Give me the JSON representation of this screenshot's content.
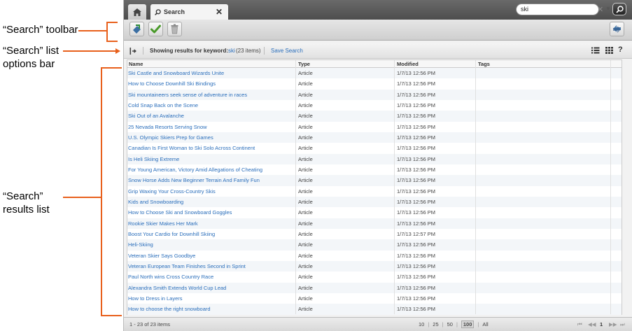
{
  "annotations": {
    "toolbar": "“Search” toolbar",
    "options_line1": "“Search” list",
    "options_line2": "options bar",
    "results_line1": "“Search”",
    "results_line2": "results list"
  },
  "tabs": {
    "home_icon": "home-icon",
    "search_tab_label": "Search",
    "close_symbol": "✕"
  },
  "global_search": {
    "value": "ski",
    "clear_symbol": "✕",
    "dropdown_symbol": "▼"
  },
  "toolbar": {
    "buttons": [
      "publish-icon",
      "approve-icon",
      "delete-icon"
    ],
    "right_button": "sync-icon"
  },
  "options_bar": {
    "showing_prefix": "Showing results for keyword:",
    "keyword": "ski",
    "count": "(23 items)",
    "save_search": "Save Search",
    "help": "?"
  },
  "table": {
    "columns": [
      "Name",
      "Type",
      "Modified",
      "Tags"
    ],
    "rows": [
      {
        "name": "Ski Castle and Snowboard Wizards Unite",
        "type": "Article",
        "modified": "1/7/13 12:56 PM"
      },
      {
        "name": "How to Choose Downhill Ski Bindings",
        "type": "Article",
        "modified": "1/7/13 12:56 PM"
      },
      {
        "name": "Ski mountaineers seek sense of adventure in races",
        "type": "Article",
        "modified": "1/7/13 12:56 PM"
      },
      {
        "name": "Cold Snap Back on the Scene",
        "type": "Article",
        "modified": "1/7/13 12:56 PM"
      },
      {
        "name": "Ski Out of an Avalanche",
        "type": "Article",
        "modified": "1/7/13 12:56 PM"
      },
      {
        "name": "25 Nevada Resorts Serving Snow",
        "type": "Article",
        "modified": "1/7/13 12:56 PM"
      },
      {
        "name": "U.S. Olympic Skiers Prep for Games",
        "type": "Article",
        "modified": "1/7/13 12:56 PM"
      },
      {
        "name": "Canadian Is First Woman to Ski Solo Across Continent",
        "type": "Article",
        "modified": "1/7/13 12:56 PM"
      },
      {
        "name": "Is Heli Skiing Extreme",
        "type": "Article",
        "modified": "1/7/13 12:56 PM"
      },
      {
        "name": "For Young American, Victory Amid Allegations of Cheating",
        "type": "Article",
        "modified": "1/7/13 12:56 PM"
      },
      {
        "name": "Snow Horse Adds New Beginner Terrain And Family Fun",
        "type": "Article",
        "modified": "1/7/13 12:56 PM"
      },
      {
        "name": "Grip Waxing Your Cross-Country Skis",
        "type": "Article",
        "modified": "1/7/13 12:56 PM"
      },
      {
        "name": "Kids and Snowboarding",
        "type": "Article",
        "modified": "1/7/13 12:56 PM"
      },
      {
        "name": "How to Choose Ski and Snowboard Goggles",
        "type": "Article",
        "modified": "1/7/13 12:56 PM"
      },
      {
        "name": "Rookie Skier Makes Her Mark",
        "type": "Article",
        "modified": "1/7/13 12:56 PM"
      },
      {
        "name": "Boost Your Cardio for Downhill Skiing",
        "type": "Article",
        "modified": "1/7/13 12:57 PM"
      },
      {
        "name": "Heli-Skiing",
        "type": "Article",
        "modified": "1/7/13 12:56 PM"
      },
      {
        "name": "Veteran Skier Says Goodbye",
        "type": "Article",
        "modified": "1/7/13 12:56 PM"
      },
      {
        "name": "Veteran European Team Finishes Second in Sprint",
        "type": "Article",
        "modified": "1/7/13 12:56 PM"
      },
      {
        "name": "Paul North wins Cross Country Race",
        "type": "Article",
        "modified": "1/7/13 12:56 PM"
      },
      {
        "name": "Alexandra Smith Extends World Cup Lead",
        "type": "Article",
        "modified": "1/7/13 12:56 PM"
      },
      {
        "name": "How to Dress in Layers",
        "type": "Article",
        "modified": "1/7/13 12:56 PM"
      },
      {
        "name": "How to choose the right snowboard",
        "type": "Article",
        "modified": "1/7/13 12:56 PM"
      }
    ]
  },
  "footer": {
    "range": "1 - 23 of 23 items",
    "page_sizes": [
      "10",
      "25",
      "50",
      "100",
      "All"
    ],
    "selected_page_size": "100",
    "separator": "|",
    "first": "⏮",
    "prev": "◀◀",
    "page": "1",
    "next": "▶▶",
    "last": "⏭"
  },
  "colors": {
    "annotation_orange": "#e8601c",
    "link_blue": "#2a6ebb"
  }
}
